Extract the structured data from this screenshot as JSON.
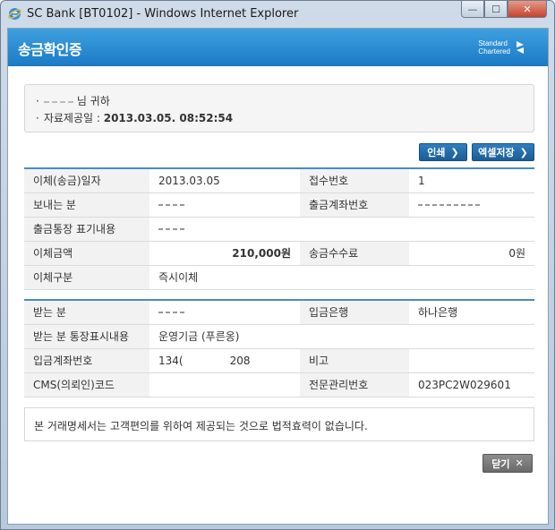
{
  "window": {
    "title": "SC Bank [BT0102] - Windows Internet Explorer",
    "controls": {
      "minimize": "—",
      "maximize": "☐",
      "close": "✕"
    }
  },
  "header": {
    "title": "송금확인증",
    "logo": {
      "line1": "Standard",
      "line2": "Chartered"
    }
  },
  "info": {
    "recipient_suffix": "님 귀하",
    "date_label": "자료제공일 :",
    "date_value": "2013.03.05.  08:52:54"
  },
  "actions": {
    "print_label": "인쇄",
    "excel_label": "엑셀저장",
    "chevron": "❯"
  },
  "transfer": {
    "rows": [
      {
        "label1": "이체(송금)일자",
        "value1": "2013.03.05",
        "label2": "접수번호",
        "value2": "1"
      },
      {
        "label1": "보내는 분",
        "value1": "",
        "label2": "출금계좌번호",
        "value2": ""
      },
      {
        "label1": "출금통장 표기내용",
        "value1": "",
        "label2": "",
        "value2": ""
      },
      {
        "label1": "이체금액",
        "value1": "210,000원",
        "label2": "송금수수료",
        "value2": "0원"
      },
      {
        "label1": "이체구분",
        "value1": "즉시이체",
        "label2": "",
        "value2": ""
      }
    ]
  },
  "receiver": {
    "rows": [
      {
        "label1": "받는 분",
        "value1": "",
        "label2": "입금은행",
        "value2": "하나은행"
      },
      {
        "label1": "받는 분 통장표시내용",
        "value1": "운영기금 (푸른옹)",
        "label2": "",
        "value2": ""
      },
      {
        "label1": "입금계좌번호",
        "value1_a": "134(",
        "value1_b": "208",
        "label2": "비고",
        "value2": ""
      },
      {
        "label1": "CMS(의뢰인)코드",
        "value1": "",
        "label2": "전문관리번호",
        "value2": "023PC2W029601"
      }
    ]
  },
  "notice": "본 거래명세서는 고객편의를 위하여 제공되는 것으로 법적효력이 없습니다.",
  "close_button": {
    "label": "닫기",
    "icon": "✕"
  }
}
